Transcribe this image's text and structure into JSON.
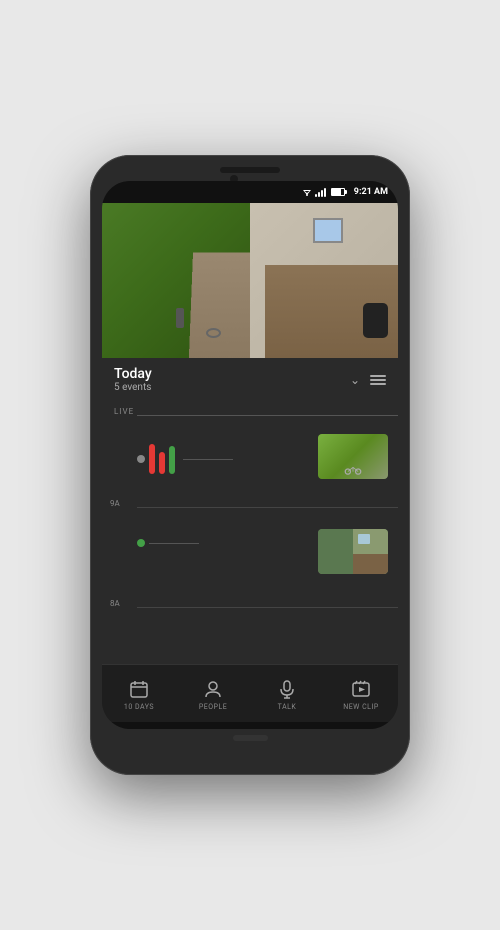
{
  "statusBar": {
    "time": "9:21 AM"
  },
  "header": {
    "title": "Today",
    "eventsCount": "5 events"
  },
  "timeline": {
    "liveLabel": "LIVE",
    "label9a": "9A",
    "label8a": "8A"
  },
  "bottomTabs": [
    {
      "id": "10days",
      "label": "10 DAYS",
      "icon": "calendar"
    },
    {
      "id": "people",
      "label": "PEOPLE",
      "icon": "person"
    },
    {
      "id": "talk",
      "label": "TALK",
      "icon": "mic"
    },
    {
      "id": "newclip",
      "label": "NEW CLIP",
      "icon": "clip"
    }
  ],
  "colors": {
    "background": "#2a2a2a",
    "accent_red": "#e53935",
    "accent_green": "#43a047",
    "text_primary": "#ffffff",
    "text_secondary": "#aaaaaa"
  }
}
